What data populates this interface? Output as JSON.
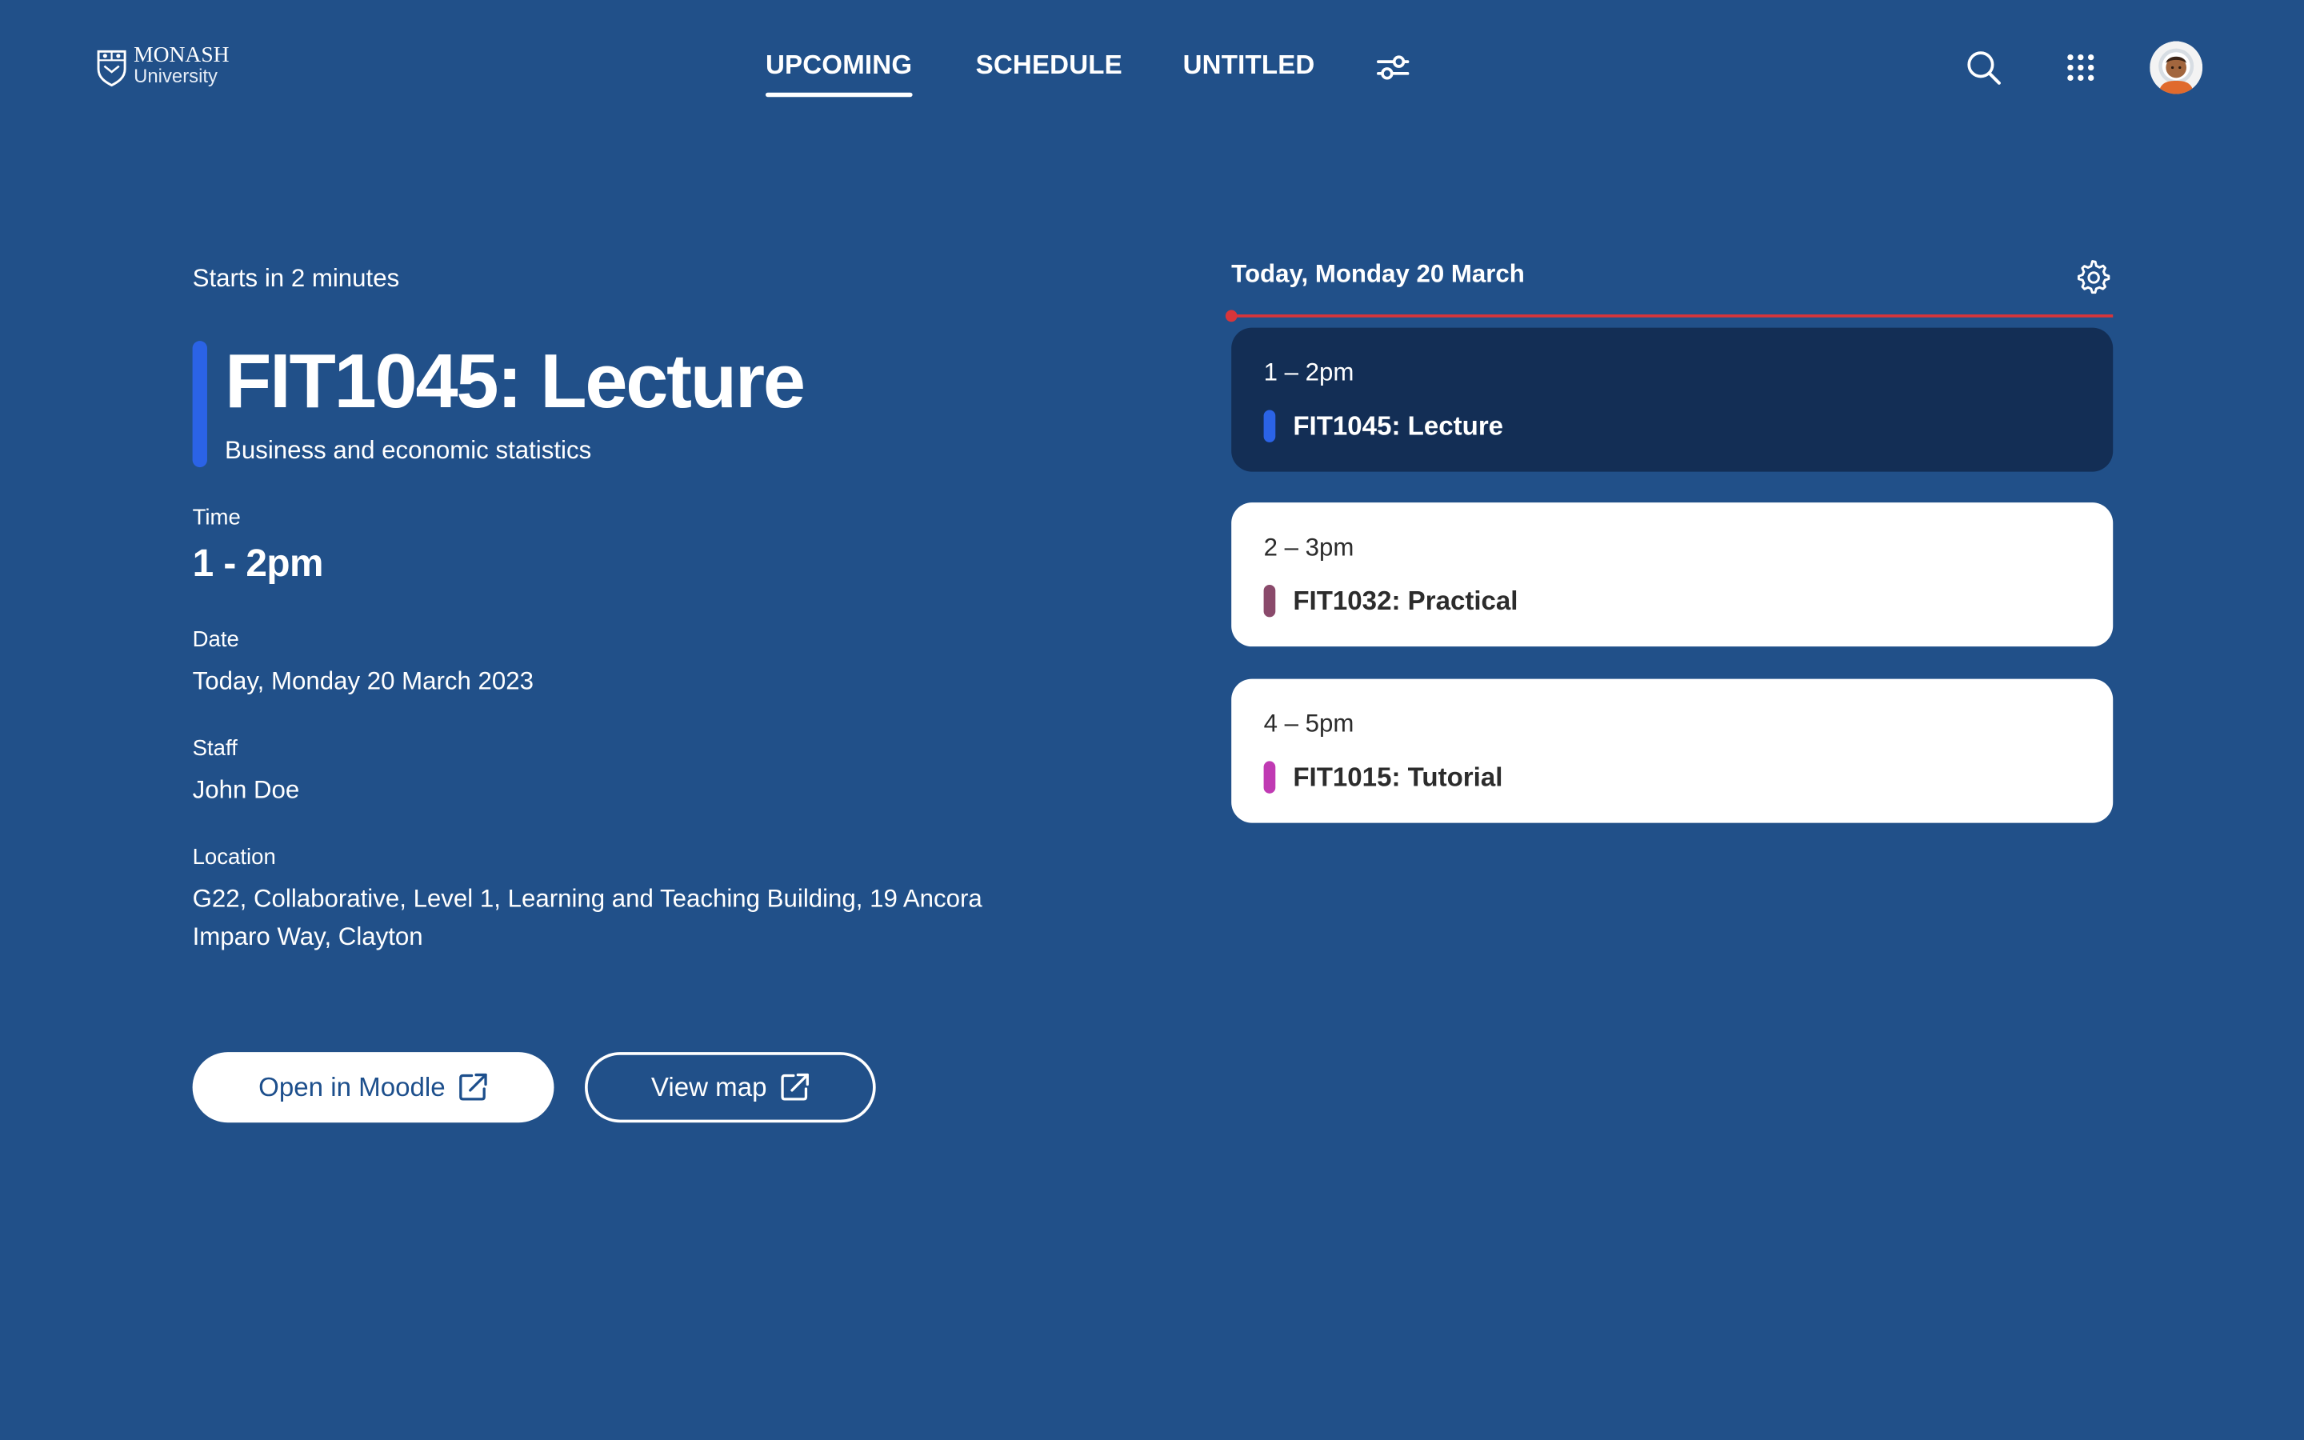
{
  "brand": {
    "logo_line1": "MONASH",
    "logo_line2": "University"
  },
  "nav": {
    "tabs": [
      {
        "label": "UPCOMING",
        "active": true
      },
      {
        "label": "SCHEDULE",
        "active": false
      },
      {
        "label": "UNTITLED",
        "active": false
      }
    ],
    "icons": [
      "sliders-icon",
      "search-icon",
      "apps-grid-icon",
      "avatar"
    ]
  },
  "detail": {
    "starts_in": "Starts in 2 minutes",
    "title": "FIT1045: Lecture",
    "subtitle": "Business and economic statistics",
    "accent_color": "#2b63e6",
    "fields": [
      {
        "label": "Time",
        "value": "1 - 2pm"
      },
      {
        "label": "Date",
        "value": "Today, Monday 20 March 2023"
      },
      {
        "label": "Staff",
        "value": "John Doe"
      },
      {
        "label": "Location",
        "value": "G22, Collaborative, Level 1, Learning and Teaching Building, 19 Ancora Imparo Way, Clayton"
      }
    ],
    "buttons": {
      "moodle": "Open in Moodle",
      "map": "View map"
    }
  },
  "schedule": {
    "heading": "Today, Monday 20 March",
    "events": [
      {
        "time": "1 – 2pm",
        "name": "FIT1045: Lecture",
        "color": "#2b63e6",
        "current": true
      },
      {
        "time": "2 – 3pm",
        "name": "FIT1032: Practical",
        "color": "#8a4a6b",
        "current": false
      },
      {
        "time": "4 – 5pm",
        "name": "FIT1015: Tutorial",
        "color": "#c03ab3",
        "current": false
      }
    ]
  },
  "colors": {
    "background": "#215089",
    "current_event_bg": "#132e55",
    "now_line": "#d8353a"
  }
}
